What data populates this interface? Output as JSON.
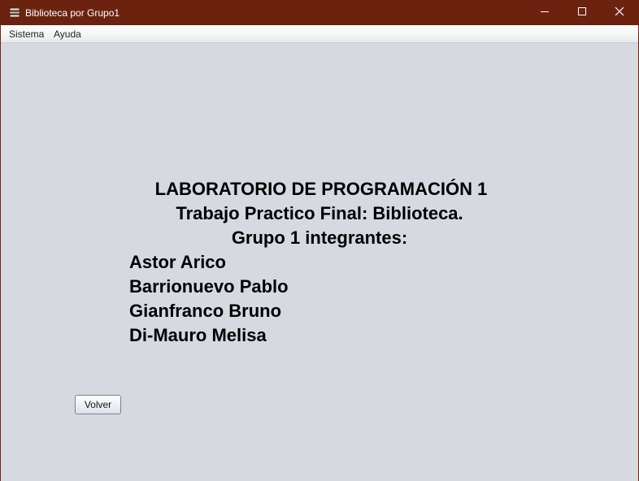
{
  "window": {
    "title": "Biblioteca por Grupo1",
    "icon": "books-stack-icon",
    "controls": {
      "minimize": "minimize-icon",
      "maximize": "maximize-icon",
      "close": "close-icon"
    },
    "colors": {
      "titlebar": "#6b2310",
      "content_background": "#d6d9e0"
    }
  },
  "menubar": {
    "items": [
      {
        "label": "Sistema"
      },
      {
        "label": "Ayuda"
      }
    ]
  },
  "credits": {
    "heading": "LABORATORIO DE PROGRAMACIÓN 1",
    "subtitle": "Trabajo Practico Final: Biblioteca.",
    "group_label": "Grupo 1 integrantes:",
    "members": [
      "Astor Arico",
      "Barrionuevo Pablo",
      "Gianfranco Bruno",
      "Di-Mauro Melisa"
    ]
  },
  "actions": {
    "back_label": "Volver"
  }
}
